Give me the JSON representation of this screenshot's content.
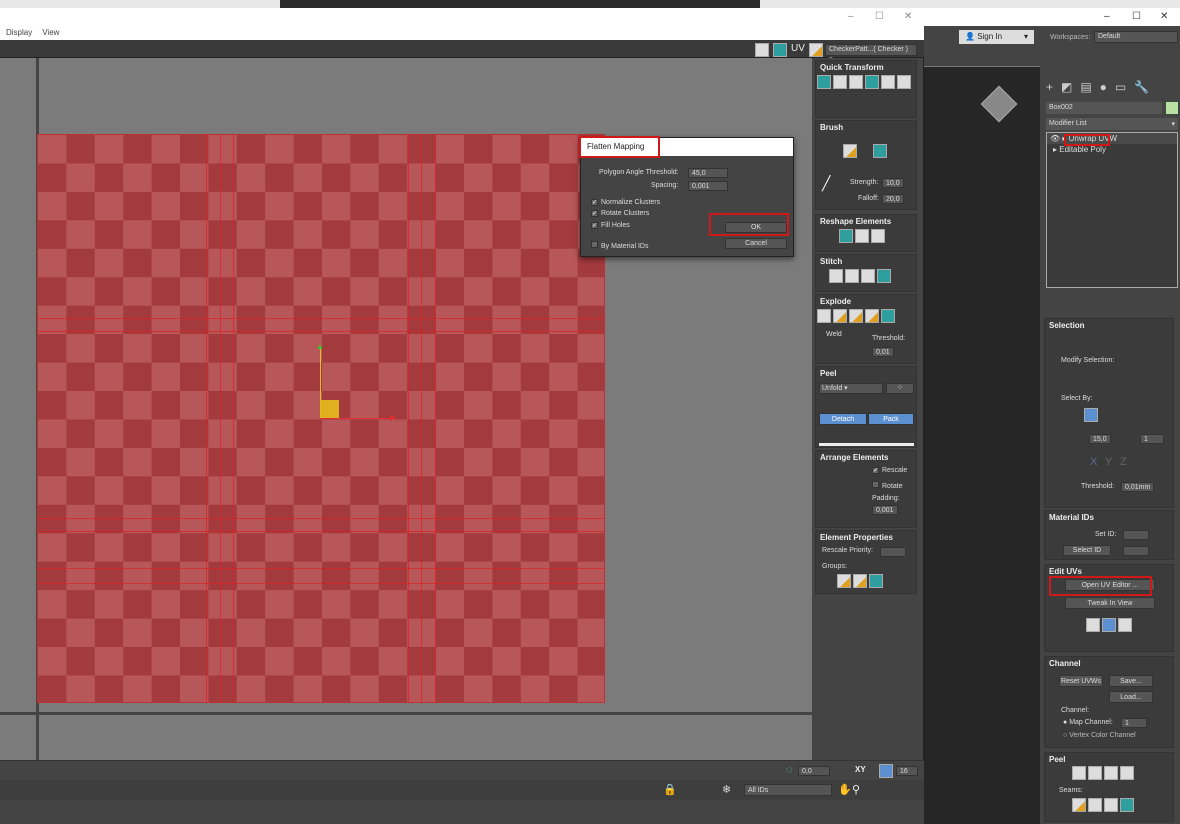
{
  "uv_editor": {
    "menu": [
      "Display",
      "View"
    ],
    "toolbar": {
      "uv_label": "UV",
      "texture_select": "CheckerPatt...( Checker )"
    },
    "rollouts": {
      "quick_transform": "Quick Transform",
      "brush": {
        "title": "Brush",
        "strength_label": "Strength:",
        "strength": "10,0",
        "falloff_label": "Falloff:",
        "falloff": "20,0"
      },
      "reshape": "Reshape Elements",
      "stitch": "Stitch",
      "explode": {
        "title": "Explode",
        "weld": "Weld",
        "threshold_label": "Threshold:",
        "threshold": "0,01"
      },
      "peel": {
        "title": "Peel",
        "mode": "Unfold",
        "detach": "Detach",
        "pack": "Pack"
      },
      "arrange": {
        "title": "Arrange Elements",
        "rescale": "Rescale",
        "rotate": "Rotate",
        "padding_label": "Padding:",
        "padding": "0,001"
      },
      "element_props": {
        "title": "Element Properties",
        "rescale_priority": "Rescale Priority:",
        "groups": "Groups:"
      }
    },
    "bottom": {
      "rotate_value": "0,0",
      "xy": "XY",
      "grid_value": "16",
      "ids_select": "All IDs"
    }
  },
  "dialog": {
    "title": "Flatten Mapping",
    "angle_label": "Polygon Angle Threshold:",
    "angle": "45,0",
    "spacing_label": "Spacing:",
    "spacing": "0,001",
    "normalize": "Normalize Clusters",
    "rotate": "Rotate Clusters",
    "fill_holes": "Fill Holes",
    "by_material": "By Material IDs",
    "ok": "OK",
    "cancel": "Cancel"
  },
  "max": {
    "sign_in": "Sign In",
    "workspaces_label": "Workspaces:",
    "workspace": "Default",
    "object_name": "Box002",
    "modifier_list": "Modifier List",
    "stack": [
      "Unwrap UVW",
      "Editable Poly"
    ],
    "selection": {
      "title": "Selection",
      "modify": "Modify Selection:",
      "select_by": "Select By:",
      "angle": "15,0",
      "count": "1",
      "threshold_label": "Threshold:",
      "threshold": "0,01mm",
      "x": "X",
      "y": "Y",
      "z": "Z"
    },
    "material_ids": {
      "title": "Material IDs",
      "set_id": "Set ID:",
      "select_id": "Select ID"
    },
    "edit_uvs": {
      "title": "Edit UVs",
      "open": "Open UV Editor ...",
      "tweak": "Tweak In View"
    },
    "channel": {
      "title": "Channel",
      "reset": "Reset UVWs",
      "save": "Save...",
      "load": "Load...",
      "channel_label": "Channel:",
      "map_channel": "Map Channel:",
      "map_value": "1",
      "vertex_color": "Vertex Color Channel"
    },
    "peel": {
      "title": "Peel",
      "seams": "Seams:"
    }
  },
  "colors": {
    "accent_red": "#d01818",
    "checker_a": "#a33a3e",
    "checker_b": "#b8575a",
    "blue_button": "#5b8fd0"
  }
}
